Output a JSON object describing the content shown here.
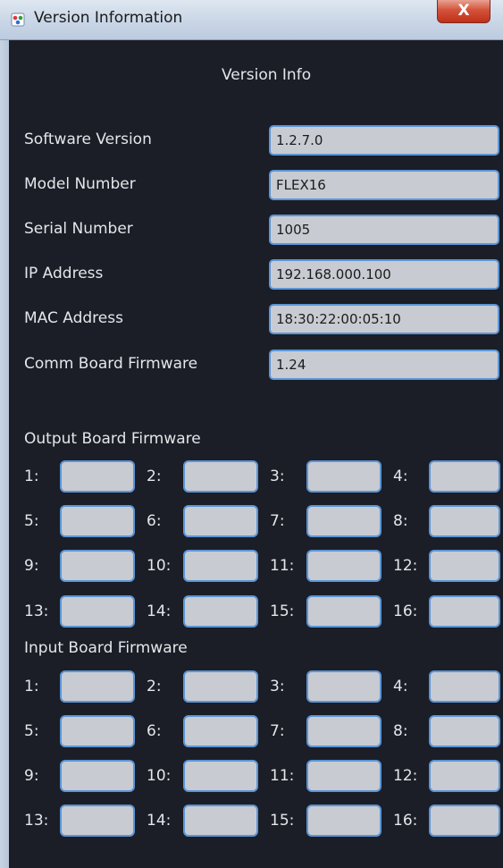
{
  "window": {
    "title": "Version Information",
    "close_label": "X"
  },
  "dialog": {
    "heading": "Version Info"
  },
  "fields": [
    {
      "label": "Software Version",
      "value": "1.2.7.0"
    },
    {
      "label": "Model Number",
      "value": "FLEX16"
    },
    {
      "label": "Serial Number",
      "value": "1005"
    },
    {
      "label": "IP Address",
      "value": "192.168.000.100"
    },
    {
      "label": "MAC Address",
      "value": "18:30:22:00:05:10"
    },
    {
      "label": "Comm Board Firmware",
      "value": "1.24"
    }
  ],
  "output_section": {
    "title": "Output Board Firmware",
    "slots": [
      "1:",
      "2:",
      "3:",
      "4:",
      "5:",
      "6:",
      "7:",
      "8:",
      "9:",
      "10:",
      "11:",
      "12:",
      "13:",
      "14:",
      "15:",
      "16:"
    ],
    "values": [
      "",
      "",
      "",
      "",
      "",
      "",
      "",
      "",
      "",
      "",
      "",
      "",
      "",
      "",
      "",
      ""
    ]
  },
  "input_section": {
    "title": "Input Board Firmware",
    "slots": [
      "1:",
      "2:",
      "3:",
      "4:",
      "5:",
      "6:",
      "7:",
      "8:",
      "9:",
      "10:",
      "11:",
      "12:",
      "13:",
      "14:",
      "15:",
      "16:"
    ],
    "values": [
      "",
      "",
      "",
      "",
      "",
      "",
      "",
      "",
      "",
      "",
      "",
      "",
      "",
      "",
      "",
      ""
    ]
  },
  "colors": {
    "background": "#1b1e26",
    "field_fill": "#c8cbd1",
    "field_border": "#5b95d8",
    "label_text": "#e4e6eb"
  }
}
